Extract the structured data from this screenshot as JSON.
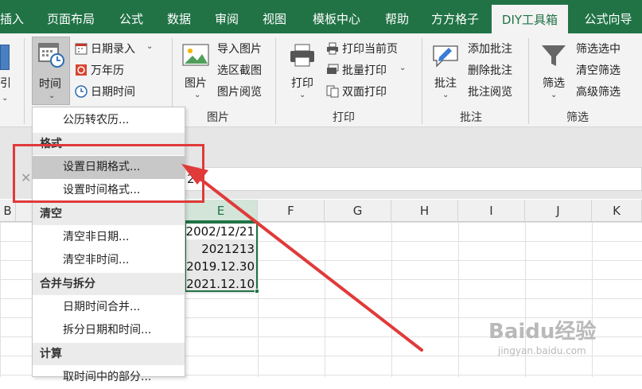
{
  "ribbon_tabs": [
    {
      "label": "插入"
    },
    {
      "label": "页面布局"
    },
    {
      "label": "公式"
    },
    {
      "label": "数据"
    },
    {
      "label": "审阅"
    },
    {
      "label": "视图"
    },
    {
      "label": "模板中心"
    },
    {
      "label": "帮助"
    },
    {
      "label": "方方格子"
    },
    {
      "label": "DIY工具箱",
      "active": true
    },
    {
      "label": "公式向导"
    }
  ],
  "ribbon": {
    "partial_left_label": "引",
    "time_group": {
      "big_button": "时间",
      "date_entry": "日期录入",
      "calendar": "万年历",
      "datetime": "日期时间"
    },
    "image_group": {
      "big_button": "图片",
      "import_image": "导入图片",
      "region_capture": "选区截图",
      "image_browse": "图片阅览",
      "group_label": "图片"
    },
    "print_group": {
      "big_button": "打印",
      "print_current": "打印当前页",
      "batch_print": "批量打印",
      "duplex_print": "双面打印",
      "group_label": "打印"
    },
    "comment_group": {
      "big_button": "批注",
      "add_comment": "添加批注",
      "delete_comment": "删除批注",
      "browse_comment": "批注阅览",
      "group_label": "批注"
    },
    "filter_group": {
      "big_button": "筛选",
      "filter_selected": "筛选选中",
      "clear_filter": "清空筛选",
      "advanced_filter": "高级筛选",
      "group_label": "筛选"
    }
  },
  "dropdown_menu": {
    "item_lunar": "公历转农历...",
    "section_format": "格式",
    "item_set_date_format": "设置日期格式...",
    "item_set_time_format": "设置时间格式...",
    "section_clear": "清空",
    "item_clear_non_date": "清空非日期...",
    "item_clear_non_time": "清空非时间...",
    "section_merge_split": "合并与拆分",
    "item_merge_datetime": "日期时间合并...",
    "item_split_datetime": "拆分日期和时间...",
    "section_calc": "计算",
    "item_time_part": "取时间中的部分..."
  },
  "formula_bar_partial": "2",
  "columns": [
    "B",
    "E",
    "F",
    "G",
    "H",
    "I",
    "J",
    "K"
  ],
  "cells": [
    "2002/12/21",
    "2021213",
    "2019.12.30",
    "2021.12.10"
  ],
  "watermark": {
    "main": "Baidu经验",
    "sub": "jingyan.baidu.com"
  },
  "colors": {
    "accent": "#217346",
    "highlight_box": "#e03a3a"
  }
}
